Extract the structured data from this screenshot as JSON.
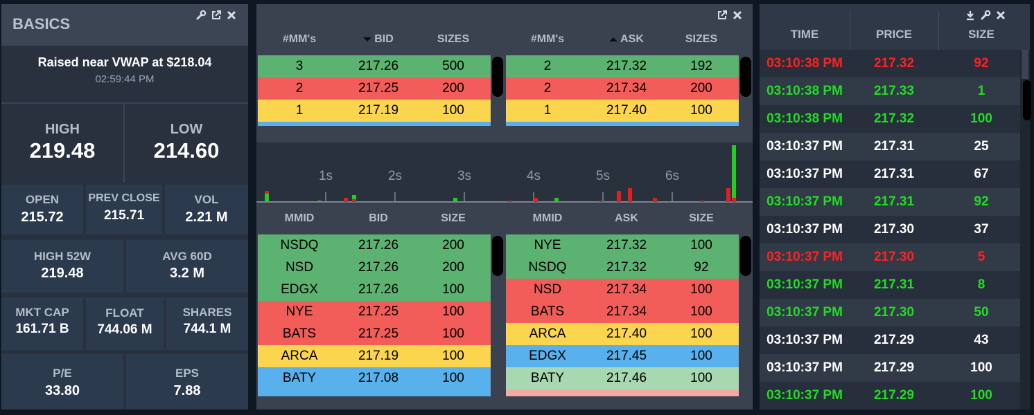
{
  "basics": {
    "title": "BASICS",
    "alert_text": "Raised near VWAP at $218.04",
    "alert_time": "02:59:44 PM",
    "high_label": "HIGH",
    "high_value": "219.48",
    "low_label": "LOW",
    "low_value": "214.60",
    "open_label": "OPEN",
    "open_value": "215.72",
    "prev_close_label": "PREV CLOSE",
    "prev_close_value": "215.71",
    "vol_label": "VOL",
    "vol_value": "2.21 M",
    "high52_label": "HIGH 52W",
    "high52_value": "219.48",
    "avg60_label": "AVG 60D",
    "avg60_value": "3.2 M",
    "mktcap_label": "MKT CAP",
    "mktcap_value": "161.71 B",
    "float_label": "FLOAT",
    "float_value": "744.06 M",
    "shares_label": "SHARES",
    "shares_value": "744.1 M",
    "pe_label": "P/E",
    "pe_value": "33.80",
    "eps_label": "EPS",
    "eps_value": "7.88"
  },
  "colors": {
    "green": "#5cb270",
    "red": "#f25c59",
    "yellow": "#fbd54e",
    "blue": "#58b0ec",
    "light_green": "#a7d8b0",
    "pink": "#f3a9a4",
    "trade_green": "#22dd22",
    "trade_red": "#ff2222",
    "trade_white": "#ffffff"
  },
  "summary": {
    "bid_headers": [
      "#MM's",
      "BID",
      "SIZES"
    ],
    "ask_headers": [
      "#MM's",
      "ASK",
      "SIZES"
    ],
    "bid_rows": [
      {
        "mm": "3",
        "price": "217.26",
        "size": "500",
        "color": "#5cb270"
      },
      {
        "mm": "2",
        "price": "217.25",
        "size": "200",
        "color": "#f25c59"
      },
      {
        "mm": "1",
        "price": "217.19",
        "size": "100",
        "color": "#fbd54e"
      }
    ],
    "ask_rows": [
      {
        "mm": "2",
        "price": "217.32",
        "size": "192",
        "color": "#5cb270"
      },
      {
        "mm": "2",
        "price": "217.34",
        "size": "200",
        "color": "#f25c59"
      },
      {
        "mm": "1",
        "price": "217.40",
        "size": "100",
        "color": "#fbd54e"
      }
    ]
  },
  "timeline": {
    "ticks": [
      "1s",
      "2s",
      "3s",
      "4s",
      "5s",
      "6s"
    ]
  },
  "level2": {
    "bid_headers": [
      "MMID",
      "BID",
      "SIZE"
    ],
    "ask_headers": [
      "MMID",
      "ASK",
      "SIZE"
    ],
    "bid_rows": [
      {
        "mm": "NSDQ",
        "price": "217.26",
        "size": "200",
        "color": "#5cb270"
      },
      {
        "mm": "NSD",
        "price": "217.26",
        "size": "200",
        "color": "#5cb270"
      },
      {
        "mm": "EDGX",
        "price": "217.26",
        "size": "100",
        "color": "#5cb270"
      },
      {
        "mm": "NYE",
        "price": "217.25",
        "size": "100",
        "color": "#f25c59"
      },
      {
        "mm": "BATS",
        "price": "217.25",
        "size": "100",
        "color": "#f25c59"
      },
      {
        "mm": "ARCA",
        "price": "217.19",
        "size": "100",
        "color": "#fbd54e"
      },
      {
        "mm": "BATY",
        "price": "217.08",
        "size": "100",
        "color": "#58b0ec"
      }
    ],
    "ask_rows": [
      {
        "mm": "NYE",
        "price": "217.32",
        "size": "100",
        "color": "#5cb270"
      },
      {
        "mm": "NSDQ",
        "price": "217.32",
        "size": "92",
        "color": "#5cb270"
      },
      {
        "mm": "NSD",
        "price": "217.34",
        "size": "100",
        "color": "#f25c59"
      },
      {
        "mm": "BATS",
        "price": "217.34",
        "size": "100",
        "color": "#f25c59"
      },
      {
        "mm": "ARCA",
        "price": "217.40",
        "size": "100",
        "color": "#fbd54e"
      },
      {
        "mm": "EDGX",
        "price": "217.45",
        "size": "100",
        "color": "#58b0ec"
      },
      {
        "mm": "BATY",
        "price": "217.46",
        "size": "100",
        "color": "#a7d8b0"
      }
    ]
  },
  "time_sales": {
    "headers": [
      "TIME",
      "PRICE",
      "SIZE"
    ],
    "rows": [
      {
        "time": "03:10:38 PM",
        "price": "217.32",
        "size": "92",
        "color": "#ff2222"
      },
      {
        "time": "03:10:38 PM",
        "price": "217.33",
        "size": "1",
        "color": "#22dd22"
      },
      {
        "time": "03:10:38 PM",
        "price": "217.32",
        "size": "100",
        "color": "#22dd22"
      },
      {
        "time": "03:10:37 PM",
        "price": "217.31",
        "size": "25",
        "color": "#ffffff"
      },
      {
        "time": "03:10:37 PM",
        "price": "217.31",
        "size": "67",
        "color": "#ffffff"
      },
      {
        "time": "03:10:37 PM",
        "price": "217.31",
        "size": "92",
        "color": "#22dd22"
      },
      {
        "time": "03:10:37 PM",
        "price": "217.30",
        "size": "37",
        "color": "#ffffff"
      },
      {
        "time": "03:10:37 PM",
        "price": "217.30",
        "size": "5",
        "color": "#ff2222"
      },
      {
        "time": "03:10:37 PM",
        "price": "217.31",
        "size": "8",
        "color": "#22dd22"
      },
      {
        "time": "03:10:37 PM",
        "price": "217.30",
        "size": "50",
        "color": "#22dd22"
      },
      {
        "time": "03:10:37 PM",
        "price": "217.29",
        "size": "43",
        "color": "#ffffff"
      },
      {
        "time": "03:10:37 PM",
        "price": "217.29",
        "size": "100",
        "color": "#ffffff"
      },
      {
        "time": "03:10:37 PM",
        "price": "217.29",
        "size": "100",
        "color": "#22dd22"
      }
    ]
  }
}
